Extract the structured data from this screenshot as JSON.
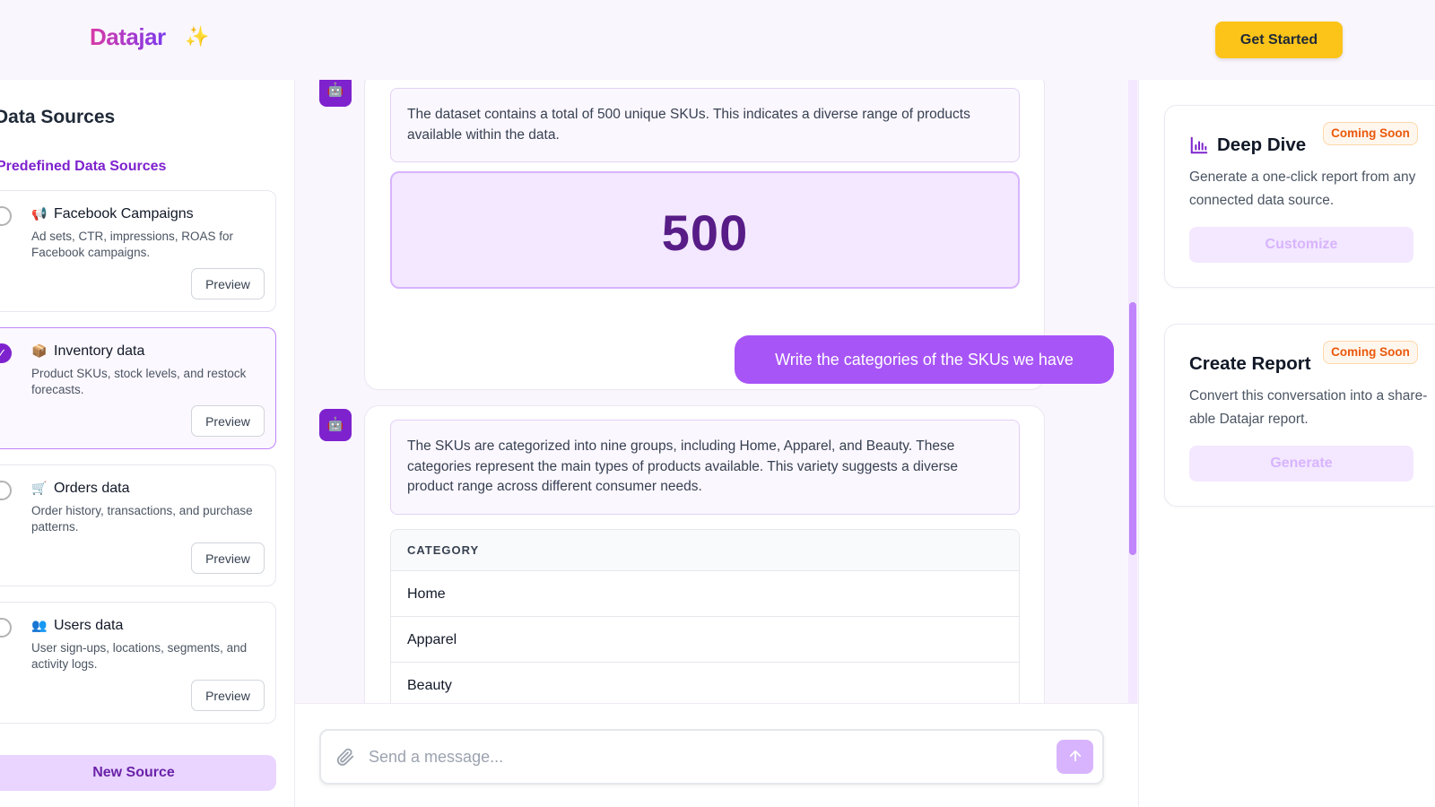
{
  "header": {
    "logo_text": "Datajar",
    "logo_spark": "✨",
    "cta_label": "Get Started"
  },
  "sidebar": {
    "title": "Data Sources",
    "subtitle": "Predefined Data Sources",
    "sources": [
      {
        "name": "Facebook Campaigns",
        "icon": "megaphone-icon",
        "glyph": "📢",
        "description": "Ad sets, CTR, impressions, ROAS for Facebook campaigns.",
        "selected": false,
        "preview_label": "Preview"
      },
      {
        "name": "Inventory data",
        "icon": "package-icon",
        "glyph": "📦",
        "description": "Product SKUs, stock levels, and restock forecasts.",
        "selected": true,
        "preview_label": "Preview"
      },
      {
        "name": "Orders data",
        "icon": "cart-icon",
        "glyph": "🛒",
        "description": "Order history, transactions, and purchase patterns.",
        "selected": false,
        "preview_label": "Preview"
      },
      {
        "name": "Users data",
        "icon": "users-icon",
        "glyph": "👥",
        "description": "User sign-ups, locations, segments, and activity logs.",
        "selected": false,
        "preview_label": "Preview"
      }
    ],
    "new_source_label": "New Source"
  },
  "chat": {
    "messages": [
      {
        "role": "assistant",
        "avatar_icon": "robot-icon",
        "text": "The dataset contains a total of 500 unique SKUs. This indicates a diverse range of products available within the data.",
        "metric": "500"
      },
      {
        "role": "user",
        "text": "Write the categories of the SKUs we have"
      },
      {
        "role": "assistant",
        "avatar_icon": "robot-icon",
        "text": "The SKUs are categorized into nine groups, including Home, Apparel, and Beauty. These categories represent the main types of products available. This variety suggests a diverse product range across different consumer needs.",
        "table": {
          "header": "CATEGORY",
          "rows": [
            "Home",
            "Apparel",
            "Beauty"
          ]
        }
      }
    ]
  },
  "composer": {
    "placeholder": "Send a message...",
    "value": "",
    "attach_icon": "paperclip-icon",
    "send_icon": "arrow-up-icon"
  },
  "actions": [
    {
      "title": "Deep Dive",
      "icon": "bar-chart-icon",
      "badge": "Coming Soon",
      "description": "Generate a one-click report from any connected data source.",
      "button_label": "Customize"
    },
    {
      "title": "Create Report",
      "badge": "Coming Soon",
      "description": "Convert this conversation into a share-able Datajar report.",
      "button_label": "Generate"
    }
  ],
  "colors": {
    "accent": "#7e22ce",
    "accent_light": "#a855f7",
    "cta": "#fcc419",
    "badge_text": "#ea580c",
    "background_tint": "#faf6fd"
  }
}
